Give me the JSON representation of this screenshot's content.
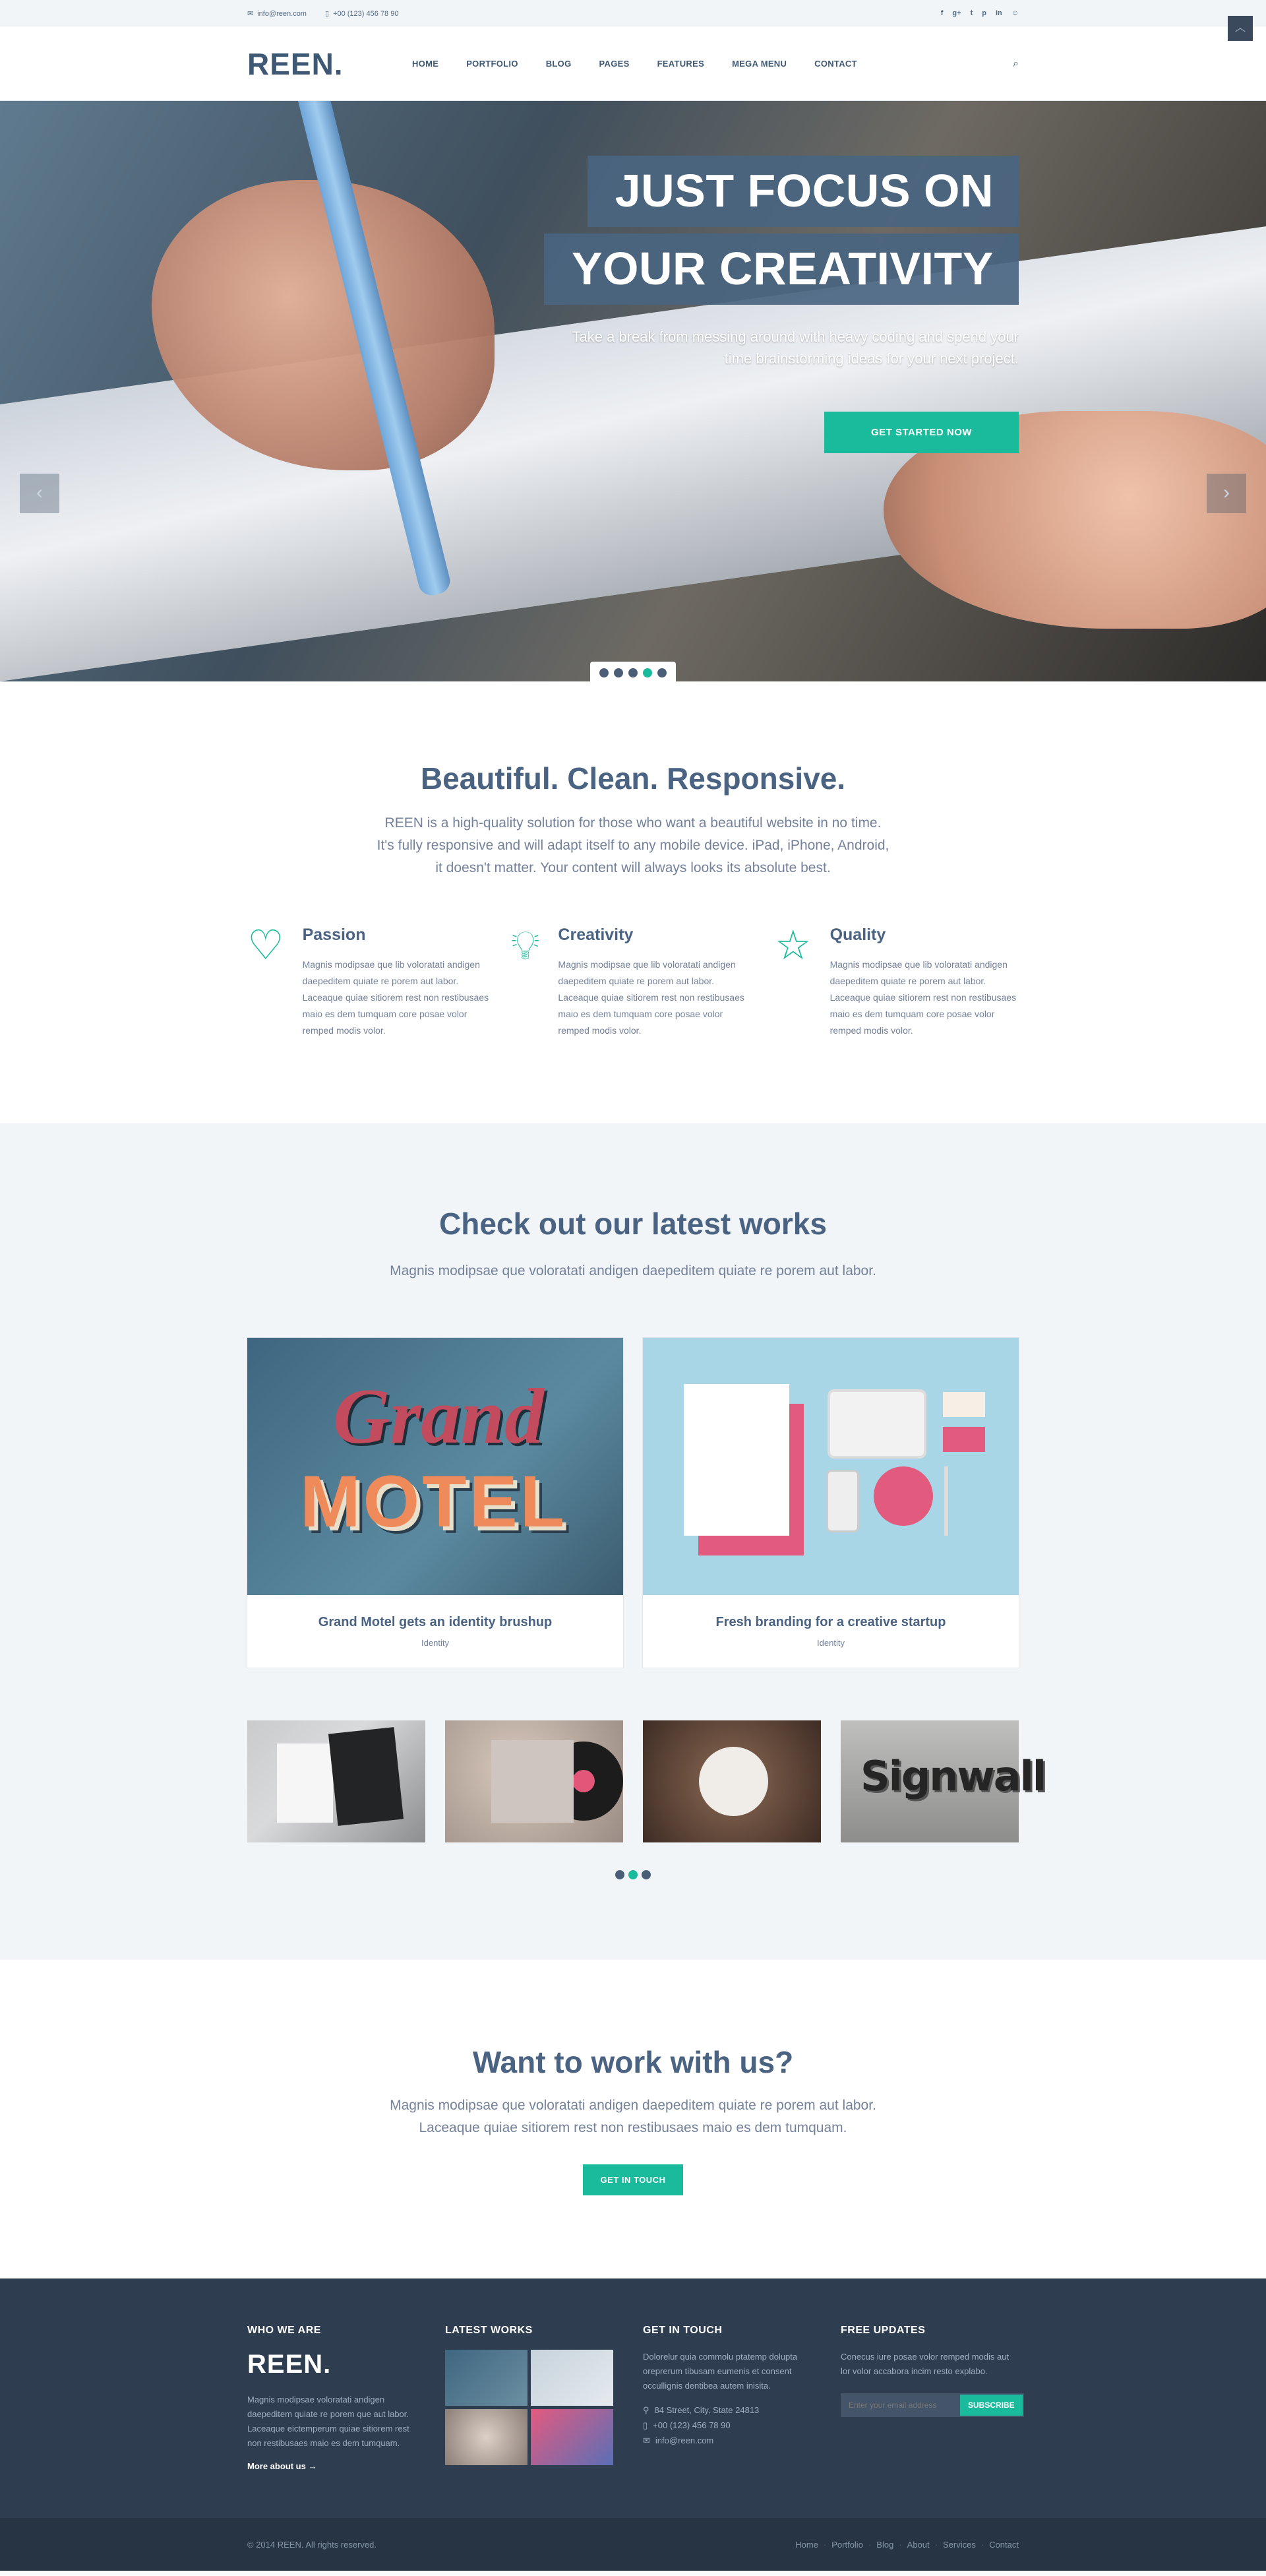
{
  "topbar": {
    "email": "info@reen.com",
    "phone": "+00 (123) 456 78 90",
    "social": [
      "f",
      "g+",
      "t",
      "p",
      "in",
      "☺"
    ]
  },
  "navbar": {
    "logo": "REEN.",
    "items": [
      "HOME",
      "PORTFOLIO",
      "BLOG",
      "PAGES",
      "FEATURES",
      "MEGA MENU",
      "CONTACT"
    ]
  },
  "hero": {
    "title_line1": "JUST FOCUS ON",
    "title_line2": "YOUR CREATIVITY",
    "subtitle_line1": "Take a break from messing around with heavy coding and spend your",
    "subtitle_line2": "time brainstorming ideas for your next project.",
    "cta": "GET STARTED NOW",
    "slides": 5,
    "active_slide": 4
  },
  "features": {
    "title": "Beautiful. Clean. Responsive.",
    "lead_line1": "REEN is a high-quality solution for those who want a beautiful website in no time.",
    "lead_line2": "It's fully responsive and will adapt itself to any mobile device. iPad, iPhone, Android,",
    "lead_line3": "it doesn't matter. Your content will always looks its absolute best.",
    "items": [
      {
        "icon": "heart-icon",
        "title": "Passion",
        "text": "Magnis modipsae que lib voloratati andigen daepeditem quiate re porem aut labor. Laceaque quiae sitiorem rest non restibusaes maio es dem tumquam core posae volor remped modis volor."
      },
      {
        "icon": "lightbulb-icon",
        "title": "Creativity",
        "text": "Magnis modipsae que lib voloratati andigen daepeditem quiate re porem aut labor. Laceaque quiae sitiorem rest non restibusaes maio es dem tumquam core posae volor remped modis volor."
      },
      {
        "icon": "star-icon",
        "title": "Quality",
        "text": "Magnis modipsae que lib voloratati andigen daepeditem quiate re porem aut labor. Laceaque quiae sitiorem rest non restibusaes maio es dem tumquam core posae volor remped modis volor."
      }
    ]
  },
  "works": {
    "title": "Check out our latest works",
    "lead": "Magnis modipsae que voloratati andigen daepeditem quiate re porem aut labor.",
    "featured": [
      {
        "title": "Grand Motel gets an identity brushup",
        "tag": "Identity",
        "art_line1": "Grand",
        "art_line2": "MOTEL"
      },
      {
        "title": "Fresh branding for a creative startup",
        "tag": "Identity"
      }
    ],
    "thumb_signwall": "Signwall"
  },
  "cta": {
    "title": "Want to work with us?",
    "lead_line1": "Magnis modipsae que voloratati andigen daepeditem quiate re porem aut labor.",
    "lead_line2": "Laceaque quiae sitiorem rest non restibusaes maio es dem tumquam.",
    "button": "GET IN TOUCH"
  },
  "footer": {
    "who_title": "WHO WE ARE",
    "logo": "REEN.",
    "who_text": "Magnis modipsae voloratati andigen daepeditem quiate re porem que aut labor. Laceaque eictemperum quiae sitiorem rest non restibusaes maio es dem tumquam.",
    "more": "More about us →",
    "works_title": "LATEST WORKS",
    "touch_title": "GET IN TOUCH",
    "touch_text": "Dolorelur quia commolu ptatemp dolupta oreprerum tibusam eumenis et consent occullignis dentibea autem inisita.",
    "address": "84 Street, City, State 24813",
    "phone": "+00 (123) 456 78 90",
    "email": "info@reen.com",
    "updates_title": "FREE UPDATES",
    "updates_text": "Conecus iure posae volor remped modis aut lor volor accabora incim resto explabo.",
    "email_placeholder": "Enter your email address",
    "subscribe": "SUBSCRIBE",
    "copyright": "© 2014 REEN. All rights reserved.",
    "links": [
      "Home",
      "Portfolio",
      "Blog",
      "About",
      "Services",
      "Contact"
    ]
  },
  "colors": {
    "accent": "#1abb9c",
    "heading": "#4a6382",
    "footer": "#2e3d4f"
  }
}
